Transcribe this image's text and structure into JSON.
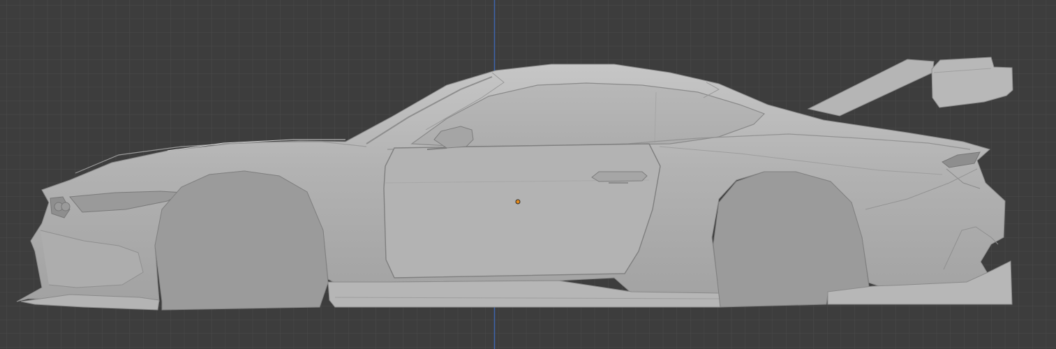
{
  "viewport": {
    "mode": "orthographic-side-view",
    "shading": "solid",
    "colors": {
      "background": "#3d3d3d",
      "grid_line": "#4a4a4a",
      "z_axis": "#3e64a8",
      "body_base": "#a9a9a9",
      "body_light": "#c4c4c4",
      "body_dark": "#8e8e8e",
      "wheel_arch": "#9a9a9a",
      "origin_marker": "#e38a1c"
    }
  },
  "object": {
    "name": "sports-car-body-mesh",
    "selected": false
  }
}
